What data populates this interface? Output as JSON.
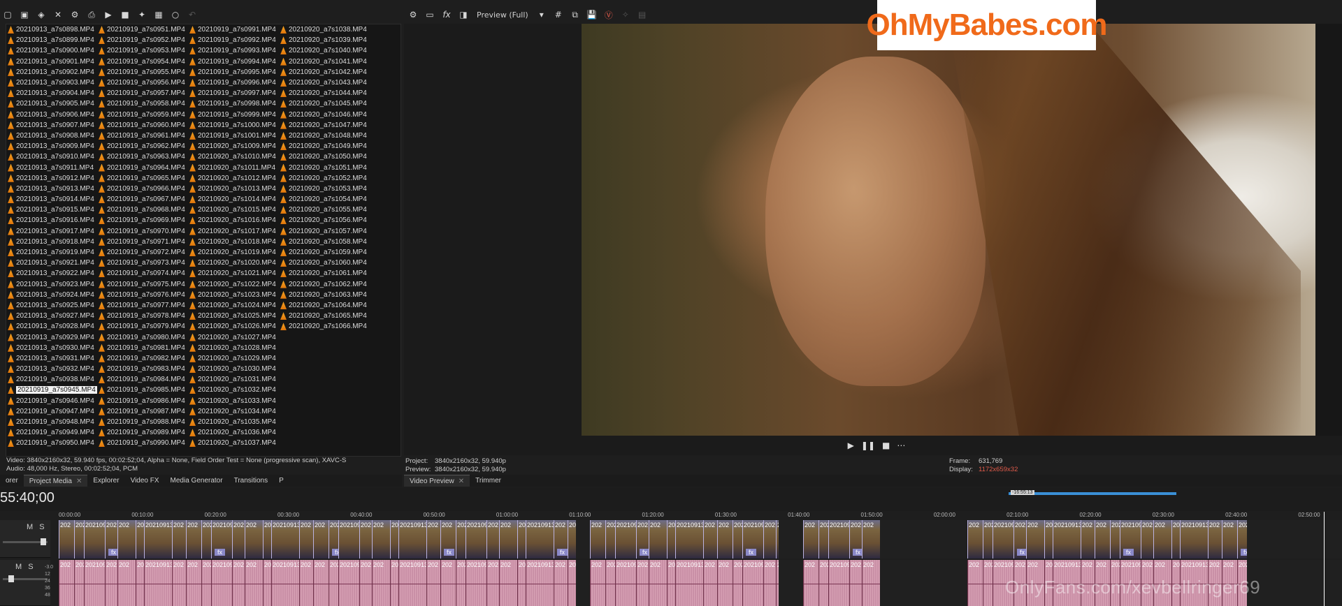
{
  "left_toolbar": [
    "new-project-icon",
    "open-icon",
    "save-icon",
    "close-icon",
    "properties-icon",
    "render-icon",
    "play-icon",
    "stop-icon",
    "media-fx-icon",
    "view-menu-icon",
    "zoom-icon",
    "undo-icon"
  ],
  "preview_toolbar": {
    "quality": "Preview (Full)"
  },
  "files": [
    "20210913_a7s0898.MP4",
    "20210913_a7s0899.MP4",
    "20210913_a7s0900.MP4",
    "20210913_a7s0901.MP4",
    "20210913_a7s0902.MP4",
    "20210913_a7s0903.MP4",
    "20210913_a7s0904.MP4",
    "20210913_a7s0905.MP4",
    "20210913_a7s0906.MP4",
    "20210913_a7s0907.MP4",
    "20210913_a7s0908.MP4",
    "20210913_a7s0909.MP4",
    "20210913_a7s0910.MP4",
    "20210913_a7s0911.MP4",
    "20210913_a7s0912.MP4",
    "20210913_a7s0913.MP4",
    "20210913_a7s0914.MP4",
    "20210913_a7s0915.MP4",
    "20210913_a7s0916.MP4",
    "20210913_a7s0917.MP4",
    "20210913_a7s0918.MP4",
    "20210913_a7s0919.MP4",
    "20210913_a7s0921.MP4",
    "20210913_a7s0922.MP4",
    "20210913_a7s0923.MP4",
    "20210913_a7s0924.MP4",
    "20210913_a7s0925.MP4",
    "20210913_a7s0927.MP4",
    "20210913_a7s0928.MP4",
    "20210913_a7s0929.MP4",
    "20210913_a7s0930.MP4",
    "20210913_a7s0931.MP4",
    "20210913_a7s0932.MP4",
    "20210919_a7s0938.MP4",
    "20210919_a7s0945.MP4",
    "20210919_a7s0946.MP4",
    "20210919_a7s0947.MP4",
    "20210919_a7s0948.MP4",
    "20210919_a7s0949.MP4",
    "20210919_a7s0950.MP4",
    "20210919_a7s0951.MP4",
    "20210919_a7s0952.MP4",
    "20210919_a7s0953.MP4",
    "20210919_a7s0954.MP4",
    "20210919_a7s0955.MP4",
    "20210919_a7s0956.MP4",
    "20210919_a7s0957.MP4",
    "20210919_a7s0958.MP4",
    "20210919_a7s0959.MP4",
    "20210919_a7s0960.MP4",
    "20210919_a7s0961.MP4",
    "20210919_a7s0962.MP4",
    "20210919_a7s0963.MP4",
    "20210919_a7s0964.MP4",
    "20210919_a7s0965.MP4",
    "20210919_a7s0966.MP4",
    "20210919_a7s0967.MP4",
    "20210919_a7s0968.MP4",
    "20210919_a7s0969.MP4",
    "20210919_a7s0970.MP4",
    "20210919_a7s0971.MP4",
    "20210919_a7s0972.MP4",
    "20210919_a7s0973.MP4",
    "20210919_a7s0974.MP4",
    "20210919_a7s0975.MP4",
    "20210919_a7s0976.MP4",
    "20210919_a7s0977.MP4",
    "20210919_a7s0978.MP4",
    "20210919_a7s0979.MP4",
    "20210919_a7s0980.MP4",
    "20210919_a7s0981.MP4",
    "20210919_a7s0982.MP4",
    "20210919_a7s0983.MP4",
    "20210919_a7s0984.MP4",
    "20210919_a7s0985.MP4",
    "20210919_a7s0986.MP4",
    "20210919_a7s0987.MP4",
    "20210919_a7s0988.MP4",
    "20210919_a7s0989.MP4",
    "20210919_a7s0990.MP4",
    "20210919_a7s0991.MP4",
    "20210919_a7s0992.MP4",
    "20210919_a7s0993.MP4",
    "20210919_a7s0994.MP4",
    "20210919_a7s0995.MP4",
    "20210919_a7s0996.MP4",
    "20210919_a7s0997.MP4",
    "20210919_a7s0998.MP4",
    "20210919_a7s0999.MP4",
    "20210919_a7s1000.MP4",
    "20210919_a7s1001.MP4",
    "20210920_a7s1009.MP4",
    "20210920_a7s1010.MP4",
    "20210920_a7s1011.MP4",
    "20210920_a7s1012.MP4",
    "20210920_a7s1013.MP4",
    "20210920_a7s1014.MP4",
    "20210920_a7s1015.MP4",
    "20210920_a7s1016.MP4",
    "20210920_a7s1017.MP4",
    "20210920_a7s1018.MP4",
    "20210920_a7s1019.MP4",
    "20210920_a7s1020.MP4",
    "20210920_a7s1021.MP4",
    "20210920_a7s1022.MP4",
    "20210920_a7s1023.MP4",
    "20210920_a7s1024.MP4",
    "20210920_a7s1025.MP4",
    "20210920_a7s1026.MP4",
    "20210920_a7s1027.MP4",
    "20210920_a7s1028.MP4",
    "20210920_a7s1029.MP4",
    "20210920_a7s1030.MP4",
    "20210920_a7s1031.MP4",
    "20210920_a7s1032.MP4",
    "20210920_a7s1033.MP4",
    "20210920_a7s1034.MP4",
    "20210920_a7s1035.MP4",
    "20210920_a7s1036.MP4",
    "20210920_a7s1037.MP4",
    "20210920_a7s1038.MP4",
    "20210920_a7s1039.MP4",
    "20210920_a7s1040.MP4",
    "20210920_a7s1041.MP4",
    "20210920_a7s1042.MP4",
    "20210920_a7s1043.MP4",
    "20210920_a7s1044.MP4",
    "20210920_a7s1045.MP4",
    "20210920_a7s1046.MP4",
    "20210920_a7s1047.MP4",
    "20210920_a7s1048.MP4",
    "20210920_a7s1049.MP4",
    "20210920_a7s1050.MP4",
    "20210920_a7s1051.MP4",
    "20210920_a7s1052.MP4",
    "20210920_a7s1053.MP4",
    "20210920_a7s1054.MP4",
    "20210920_a7s1055.MP4",
    "20210920_a7s1056.MP4",
    "20210920_a7s1057.MP4",
    "20210920_a7s1058.MP4",
    "20210920_a7s1059.MP4",
    "20210920_a7s1060.MP4",
    "20210920_a7s1061.MP4",
    "20210920_a7s1062.MP4",
    "20210920_a7s1063.MP4",
    "20210920_a7s1064.MP4",
    "20210920_a7s1065.MP4",
    "20210920_a7s1066.MP4"
  ],
  "selected_file": "20210919_a7s0945.MP4",
  "media_info": {
    "video": "Video: 3840x2160x32, 59.940 fps, 00:02:52;04, Alpha = None, Field Order Test = None (progressive scan), XAVC-S",
    "audio": "Audio: 48,000 Hz, Stereo, 00:02:52;04, PCM"
  },
  "left_tabs": [
    {
      "label": "orer",
      "active": false
    },
    {
      "label": "Project Media",
      "active": true
    },
    {
      "label": "Explorer",
      "active": false
    },
    {
      "label": "Video FX",
      "active": false
    },
    {
      "label": "Media Generator",
      "active": false
    },
    {
      "label": "Transitions",
      "active": false
    },
    {
      "label": "P",
      "active": false
    }
  ],
  "right_tabs": [
    {
      "label": "Video Preview",
      "active": true
    },
    {
      "label": "Trimmer",
      "active": false
    }
  ],
  "preview_info": {
    "project_label": "Project:",
    "project": "3840x2160x32, 59.940p",
    "preview_label": "Preview:",
    "preview": "3840x2160x32, 59.940p",
    "frame_label": "Frame:",
    "frame": "631,769",
    "display_label": "Display:",
    "display": "1172x659x32"
  },
  "watermark": "OhMyBabes.com",
  "footer_watermark": "OnlyFans.com/xevbellringer69",
  "timeline": {
    "timecode": "55:40;00",
    "marker": "-16:55:13",
    "ruler": [
      "00:00:00",
      "00:10:00",
      "00:20:00",
      "00:30:00",
      "00:40:00",
      "00:50:00",
      "01:00:00",
      "01:10:00",
      "01:20:00",
      "01:30:00",
      "01:40:00",
      "01:50:00",
      "02:00:00",
      "02:10:00",
      "02:20:00",
      "02:30:00",
      "02:40:00",
      "02:50:00"
    ],
    "video_track": {
      "mute": "M",
      "solo": "S"
    },
    "audio_track": {
      "mute": "M",
      "solo": "S",
      "levels": [
        "-3.0",
        "12",
        "24",
        "36",
        "48"
      ]
    },
    "clip_label": "20210913",
    "clip_label_alt": "202",
    "fx_label": "fx"
  },
  "transport": {
    "play": "▶",
    "pause": "❚❚",
    "stop": "■",
    "more": "⋯"
  },
  "colors": {
    "accent": "#3a8fd6",
    "audio_clip": "#d8a2b5",
    "video_clip_border": "#bab2e0",
    "watermark_text": "#f06a1a"
  }
}
